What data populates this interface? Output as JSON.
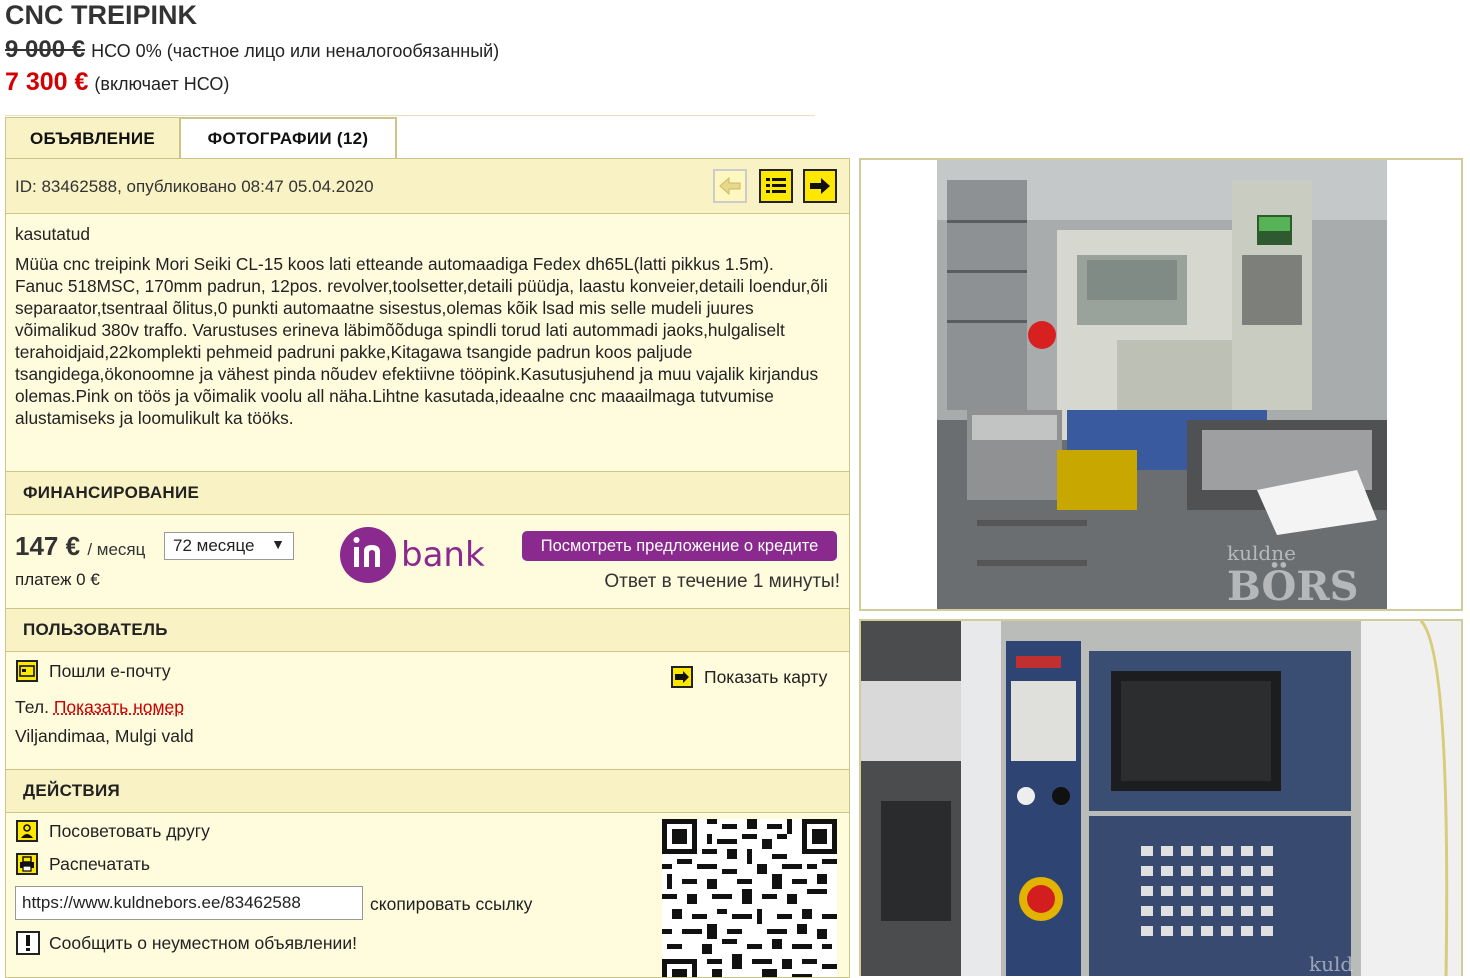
{
  "listing": {
    "title": "CNC TREIPINK",
    "old_price": "9 000 €",
    "old_price_note": "НСО 0% (частное лицо или неналогообязанный)",
    "price": "7 300 €",
    "price_note": "(включает НСО)"
  },
  "tabs": [
    {
      "label": "ОБЪЯВЛЕНИЕ",
      "active": true
    },
    {
      "label": "ФОТОГРАФИИ (12)",
      "active": false
    }
  ],
  "meta": {
    "id_line": "ID: 83462588, опубликовано 08:47 05.04.2020"
  },
  "nav": {
    "back_icon": "arrow-left-icon",
    "list_icon": "list-icon",
    "next_icon": "arrow-right-icon"
  },
  "description": {
    "condition": "kasutatud",
    "text": "Müüa cnc treipink Mori Seiki CL-15 koos lati etteande automaadiga Fedex dh65L(latti pikkus 1.5m).\nFanuc 518MSC, 170mm padrun, 12pos. revolver,toolsetter,detaili püüdja, laastu konveier,detaili loendur,õli separaator,tsentraal õlitus,0 punkti automaatne sisestus,olemas kõik lsad mis selle mudeli juures võimalikud 380v traffo. Varustuses erineva läbimõõduga spindli torud lati autommadi jaoks,hulgaliselt terahoidjaid,22komplekti pehmeid padruni pakke,Kitagawa tsangide padrun koos paljude tsangidega,ökonoomne ja vähest pinda nõudev efektiivne tööpink.Kasutusjuhend ja muu vajalik kirjandus olemas.Pink on töös ja võimalik voolu all näha.Lihtne kasutada,ideaalne cnc maaailmaga tutvumise alustamiseks ja loomulikult ka tööks."
  },
  "financing": {
    "heading": "ФИНАНСИРОВАНИЕ",
    "monthly": "147 €",
    "per_month": "/ месяц",
    "months_selected": "72 месяце",
    "payment": "платеж 0 €",
    "lender_logo": "inbank",
    "offer_button": "Посмотреть предложение о кредите",
    "answer_note": "Ответ в течение 1 минуты!"
  },
  "user": {
    "heading": "ПОЛЬЗОВАТЕЛЬ",
    "email_label": "Пошли е-почту",
    "phone_prefix": "Тел.",
    "phone_link": "Показать номер",
    "location": "Viljandimaa, Mulgi vald",
    "map_label": "Показать карту"
  },
  "actions": {
    "heading": "ДЕЙСТВИЯ",
    "recommend": "Посоветовать другу",
    "print": "Распечатать",
    "url": "https://www.kuldnebors.ee/83462588",
    "copy_link": "скопировать ссылку",
    "report": "Сообщить о неуместном объявлении!"
  },
  "photos": {
    "watermark_1": "kuldne",
    "watermark_2": "BÖRS",
    "watermark_3": "kuld"
  },
  "colors": {
    "accent_yellow": "#ffe800",
    "panel_bg": "#fffbdd",
    "header_bg": "#f8f2c4",
    "border": "#cdc487",
    "price_red": "#d40000",
    "inbank_purple": "#8a2a8f"
  }
}
